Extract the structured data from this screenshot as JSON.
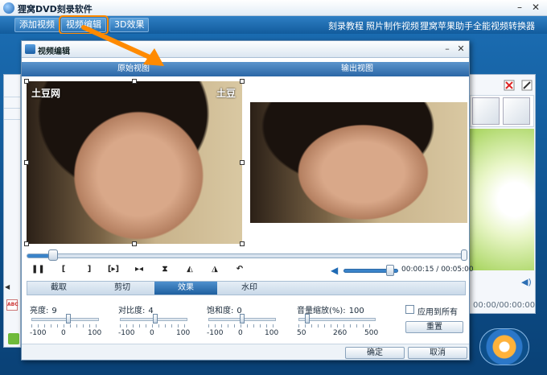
{
  "app": {
    "title": "狸窝DVD刻录软件",
    "minimize_icon": "minimize-icon",
    "close_icon": "close-icon"
  },
  "toolbar": {
    "tabs": [
      "添加视频",
      "视频编辑",
      "3D效果"
    ],
    "links": [
      "刻录教程",
      "照片制作视频",
      "狸窝苹果助手",
      "全能视频转换器"
    ]
  },
  "dialog": {
    "title": "视频编辑",
    "view_tabs": [
      "原始视图",
      "输出视图"
    ],
    "watermark_left": "土豆网",
    "watermark_right": "土豆",
    "playback": {
      "buttons": [
        "pause-icon",
        "mark-in-icon",
        "mark-out-icon",
        "next-frame-icon",
        "skip-end-icon",
        "split-icon",
        "flip-icon",
        "mirror-icon",
        "undo-icon"
      ],
      "current_time": "00:00:15",
      "total_time": "00:05:00",
      "time_separator": " / ",
      "progress_fraction": 0.05,
      "volume_fraction": 0.85
    },
    "edit_tabs": [
      "截取",
      "剪切",
      "效果",
      "水印"
    ],
    "active_tab": "效果",
    "sliders": [
      {
        "label": "亮度:",
        "value": "9",
        "ticks": [
          "-100",
          "0",
          "100"
        ],
        "fraction": 0.545
      },
      {
        "label": "对比度:",
        "value": "4",
        "ticks": [
          "-100",
          "0",
          "100"
        ],
        "fraction": 0.52
      },
      {
        "label": "饱和度:",
        "value": "0",
        "ticks": [
          "-100",
          "0",
          "100"
        ],
        "fraction": 0.5
      },
      {
        "label": "音量缩放(%):",
        "value": "100",
        "ticks": [
          "50",
          "260",
          "500"
        ],
        "fraction": 0.11
      }
    ],
    "apply_all_label": "应用到所有",
    "apply_all_checked": false,
    "reset_button": "重置",
    "ok_button": "确定",
    "cancel_button": "取消"
  },
  "side": {
    "time_text": "00:00/00:00:00"
  },
  "colors": {
    "brand_blue": "#1a6bb0",
    "highlight_orange": "#ff8a00",
    "active_tab": "#1e5f9f"
  }
}
